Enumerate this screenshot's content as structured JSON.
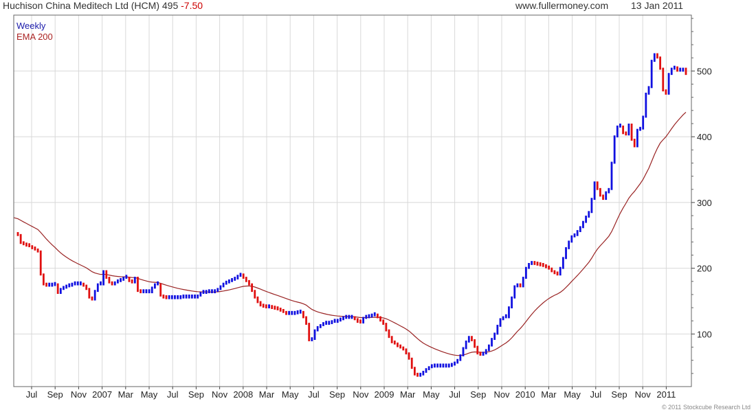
{
  "header": {
    "title": "Huchison China Meditech Ltd (HCM) 495",
    "change": "-7.50",
    "site": "www.fullermoney.com",
    "date": "13 Jan 2011"
  },
  "legend": {
    "weekly": "Weekly",
    "ema": "EMA 200"
  },
  "copyright": "© 2011 Stockcube Research Ltd",
  "colors": {
    "up": "#1010e0",
    "down": "#e01010",
    "ema": "#992222",
    "grid": "#d8d8d8"
  },
  "chart_data": {
    "type": "line",
    "ylim": [
      20,
      585
    ],
    "grid": true,
    "y_ticks": [
      100,
      200,
      300,
      400,
      500
    ],
    "x_ticks": [
      "Jul",
      "Sep",
      "Nov",
      "2007",
      "Mar",
      "May",
      "Jul",
      "Sep",
      "Nov",
      "2008",
      "Mar",
      "May",
      "Jul",
      "Sep",
      "Nov",
      "2009",
      "Mar",
      "May",
      "Jul",
      "Sep",
      "Nov",
      "2010",
      "Mar",
      "May",
      "Jul",
      "Sep",
      "Nov",
      "2011"
    ],
    "weekly_closes": [
      250,
      238,
      236,
      234,
      233,
      230,
      228,
      225,
      190,
      175,
      173,
      173,
      174,
      175,
      162,
      168,
      170,
      172,
      173,
      175,
      175,
      175,
      175,
      173,
      168,
      155,
      152,
      165,
      175,
      175,
      195,
      185,
      178,
      175,
      178,
      180,
      182,
      185,
      185,
      180,
      178,
      185,
      165,
      163,
      163,
      163,
      163,
      170,
      175,
      175,
      158,
      155,
      154,
      154,
      154,
      154,
      154,
      155,
      155,
      155,
      155,
      155,
      155,
      158,
      162,
      162,
      163,
      163,
      163,
      165,
      168,
      172,
      176,
      178,
      180,
      182,
      184,
      188,
      190,
      185,
      180,
      175,
      165,
      155,
      148,
      143,
      141,
      140,
      140,
      139,
      138,
      137,
      135,
      133,
      130,
      130,
      130,
      131,
      132,
      133,
      125,
      115,
      90,
      92,
      105,
      110,
      113,
      115,
      115,
      116,
      118,
      118,
      120,
      122,
      124,
      124,
      124,
      125,
      122,
      118,
      117,
      124,
      125,
      126,
      128,
      129,
      125,
      120,
      115,
      105,
      95,
      87,
      85,
      81,
      79,
      76,
      70,
      62,
      48,
      38,
      36,
      38,
      42,
      46,
      49,
      50,
      50,
      50,
      50,
      50,
      50,
      51,
      53,
      56,
      60,
      67,
      78,
      88,
      95,
      90,
      80,
      70,
      68,
      70,
      75,
      82,
      92,
      100,
      112,
      122,
      125,
      125,
      140,
      155,
      172,
      175,
      172,
      185,
      200,
      206,
      208,
      206,
      205,
      204,
      203,
      201,
      199,
      195,
      192,
      190,
      200,
      215,
      230,
      240,
      248,
      250,
      256,
      262,
      270,
      278,
      285,
      305,
      330,
      320,
      310,
      305,
      315,
      320,
      360,
      400,
      415,
      415,
      405,
      403,
      418,
      395,
      385,
      410,
      412,
      430,
      465,
      475,
      515,
      525,
      520,
      503,
      470,
      465,
      495,
      503,
      505,
      500,
      500,
      503,
      495
    ]
  }
}
